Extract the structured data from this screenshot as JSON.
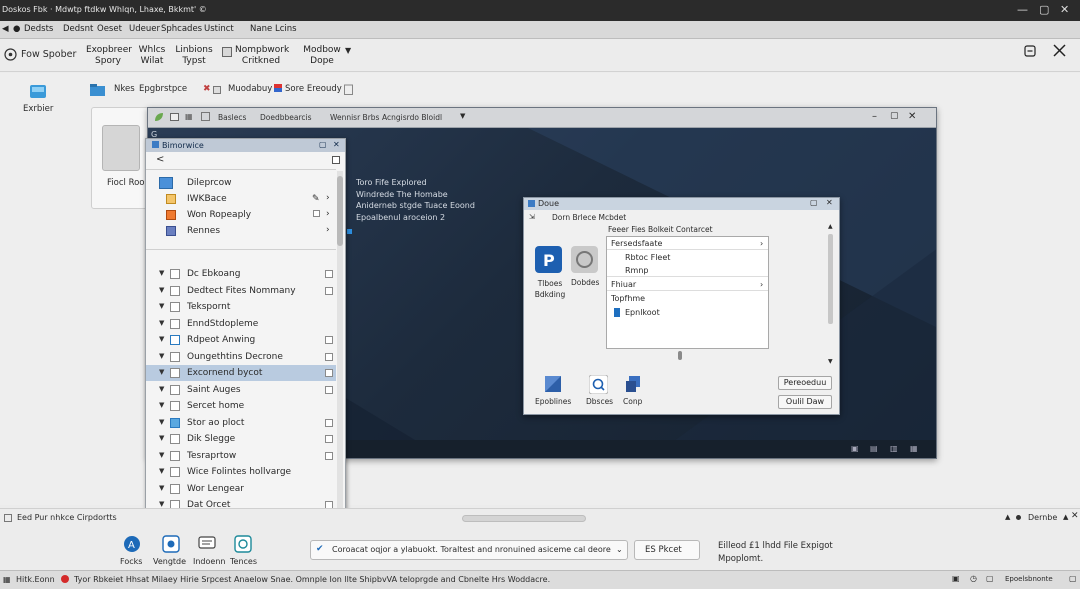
{
  "titlebar": {
    "title": "Doskos Fbk  ·  Mdwtp ftdkw  Whlqn, Lhaxe,  Bkkmt'  ©",
    "minimize": "—",
    "maximize": "▢",
    "close": "✕"
  },
  "tabbar": {
    "back": "◀",
    "items": [
      "Dedsts",
      "Dedsnt",
      "Oeset",
      "Udeuer",
      "Sphcades",
      "Ustinct",
      "Nane",
      "Lcins"
    ]
  },
  "toolbar": {
    "app_label": "Fow Spober",
    "buttons": [
      {
        "line1": "Exopbreer",
        "line2": "Spory"
      },
      {
        "line1": "Whlcs",
        "line2": "Wilat"
      },
      {
        "line1": "Linbions",
        "line2": "Typst"
      },
      {
        "line1": "Nompbwork",
        "line2": "Critkned"
      },
      {
        "line1": "Modbow",
        "line2": "Dope"
      }
    ],
    "modbow_arrow": "▼"
  },
  "desktop": {
    "icon_label": "Exrbier",
    "shortcuts": [
      "Nkes",
      "Epgbrstpce",
      "Muodabuy",
      "Sore Ereoudy"
    ],
    "card_label": "Fiocl Roor"
  },
  "inner_window": {
    "title_items": [
      "Baslecs",
      "Doedbbearcis",
      "Wennisr Brbs",
      "Acngisrdo Bloidl"
    ],
    "bg_lines": [
      "Toro Fife Explored",
      "Windrede The Homabe",
      "Aniderneb stgde Tuace Eoond",
      "Epoalbenul aroceion 2"
    ],
    "small_label": "G"
  },
  "panel": {
    "title": "Bimorwice",
    "back": "<",
    "top_items": [
      {
        "label": "Dileprcow",
        "color": "#4a90d9"
      },
      {
        "label": "IWKBace",
        "color": "#e0a030"
      },
      {
        "label": "Won Ropeaply",
        "color": "#e06030"
      },
      {
        "label": "Rennes",
        "color": "#5a70b0"
      }
    ],
    "rows": [
      {
        "label": "Dc Ebkoang",
        "check": false
      },
      {
        "label": "Dedtect Fites Nommany",
        "check": false
      },
      {
        "label": "Tekspornt",
        "check": false
      },
      {
        "label": "EnndStdopleme",
        "check": false
      },
      {
        "label": "Rdpeot Anwing",
        "check": true
      },
      {
        "label": "Oungethtins Decrone",
        "check": false
      },
      {
        "label": "Excornend bycot",
        "check": false,
        "selected": true
      },
      {
        "label": "Saint Auges",
        "check": false
      },
      {
        "label": "Sercet home",
        "check": false
      },
      {
        "label": "Stor ao ploct",
        "check": true
      },
      {
        "label": "Dik Slegge",
        "check": false
      },
      {
        "label": "Tesraprtow",
        "check": false
      },
      {
        "label": "Wice Folintes hollvarge",
        "check": false
      },
      {
        "label": "Wor Lengear",
        "check": false
      },
      {
        "label": "Dat Orcet",
        "check": false
      }
    ]
  },
  "dialog": {
    "title": "Doue",
    "subtitle": "Dorn Brlece Mcbdet",
    "icon1_label": "Tlboes\nBdkding",
    "icon2_label": "Dobdes",
    "heading": "Feeer Fies Bolkeit Contarcet",
    "menu": [
      {
        "label": "Fersedsfaate",
        "arrow": "›"
      },
      {
        "label": "Rbtoc Fleet",
        "arrow": ""
      },
      {
        "label": "Rmnp",
        "arrow": ""
      },
      {
        "label": "Fhiuar",
        "arrow": "›"
      },
      {
        "label": "Topfhme",
        "arrow": ""
      },
      {
        "label": "Epnlkoot",
        "arrow": ""
      }
    ],
    "bottom_icons": [
      "Epoblines",
      "Dbsces",
      "Conp"
    ],
    "button1": "Pereoeduu",
    "button2": "Oulil Daw"
  },
  "status1": {
    "left": "Eed Pur nhkce Cirpdortts",
    "right": "Dernbe"
  },
  "bottompanel": {
    "icons": [
      "Focks",
      "Vengtde",
      "Indoenn",
      "Tences"
    ],
    "message": "Coroacat oqjor a ylabuokt. Toraltest and nronuined asiceme cal deore",
    "dropdown": "ES Pkcet",
    "info_line1": "Eilleod £1 lhdd File Expigot",
    "info_line2": "Mpoplomt."
  },
  "status2": {
    "left": "Hitk.Eonn",
    "text": "Tyor Rbkeiet Hhsat Milaey Hirie Srpcest Anaelow Snae. Omnple Ion llte ShipbvVA teloprgde and Cbnelte Hrs Woddacre.",
    "right": "Epoelsbnonte"
  },
  "colors": {
    "accent": "#1a6fc0",
    "inner_bg": "#1f2d40",
    "selection": "#b9cbe0"
  }
}
